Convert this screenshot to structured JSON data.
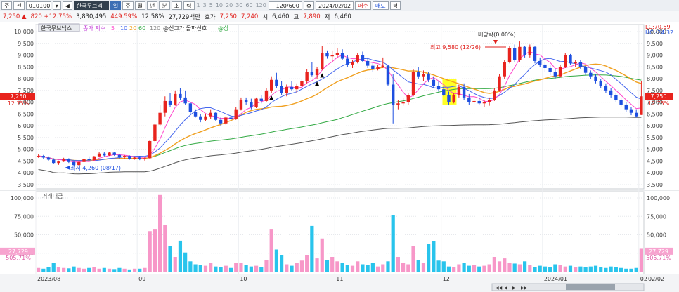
{
  "toolbar": {
    "type_label": "주",
    "board_label": "전",
    "code": "010100",
    "name": "한국무브넥",
    "buttons": [
      "일",
      "주",
      "월",
      "년",
      "분",
      "초",
      "틱"
    ],
    "periods": [
      "1",
      "3",
      "5",
      "10",
      "20",
      "30",
      "60",
      "120"
    ],
    "count": "120",
    "count_total": "/600",
    "date": "2024/02/02",
    "buy": "매수",
    "sell": "매도",
    "avg": "평"
  },
  "quote": {
    "price": "7,250",
    "change": "820",
    "change_pct": "+12.75%",
    "volume": "3,830,495",
    "volume_ratio": "449.59%",
    "turnover": "12.58%",
    "amount": "27,729백만",
    "bid_label": "호가",
    "bid": "7,250",
    "ask": "7,240",
    "open_label": "시",
    "open": "6,460",
    "high_label": "고",
    "high": "7,890",
    "low_label": "저",
    "low": "6,460"
  },
  "legend": {
    "name": "한국무브넥스",
    "ma_title": "종가 지수",
    "ma_periods": [
      "5",
      "10",
      "20",
      "60",
      "120"
    ],
    "signal1": "@신고가 돌파신호",
    "signal2": "@상"
  },
  "annotations": {
    "high_label": "최고 9,580 (12/26)",
    "low_label": "최저 4,260 (08/17)",
    "dividend": "배당락(0.00%)",
    "lc": "LC:70.59",
    "hc": "HC:-24.32",
    "price_tag": "7,250",
    "pct_tag": "12.75%",
    "vol_panel_title": "거래대금",
    "vol_tag": "27,729",
    "vol_pct_tag": "505.71%"
  },
  "chart_data": {
    "type": "candlestick",
    "price_axis": {
      "min": 3500,
      "max": 10000,
      "ticks": [
        3500,
        4000,
        4500,
        5000,
        5500,
        6000,
        6500,
        7000,
        7500,
        8000,
        8500,
        9000,
        9500,
        10000
      ]
    },
    "volume_axis": {
      "min": 0,
      "max": 100000,
      "ticks": [
        25000,
        50000,
        75000,
        100000
      ]
    },
    "x_labels": [
      {
        "label": "2023/08",
        "index": 0
      },
      {
        "label": "09",
        "index": 20
      },
      {
        "label": "10",
        "index": 40
      },
      {
        "label": "11",
        "index": 59
      },
      {
        "label": "12",
        "index": 80
      },
      {
        "label": "2024/01",
        "index": 100
      },
      {
        "label": "02",
        "index": 119
      }
    ],
    "right_date": "02/02",
    "ma_colors": {
      "5": "#ff44cc",
      "10": "#4466ee",
      "20": "#f0a020",
      "60": "#33aa44",
      "120": "#555555"
    },
    "highlight_index": 81,
    "up_arrows": [
      46,
      55,
      56
    ],
    "candles": [
      [
        4700,
        4780,
        4640,
        4720
      ],
      [
        4720,
        4760,
        4600,
        4650
      ],
      [
        4650,
        4700,
        4520,
        4560
      ],
      [
        4560,
        4620,
        4380,
        4420
      ],
      [
        4420,
        4520,
        4340,
        4480
      ],
      [
        4480,
        4640,
        4460,
        4600
      ],
      [
        4600,
        4620,
        4420,
        4460
      ],
      [
        4460,
        4500,
        4260,
        4330
      ],
      [
        4330,
        4500,
        4300,
        4460
      ],
      [
        4460,
        4620,
        4440,
        4600
      ],
      [
        4600,
        4700,
        4500,
        4540
      ],
      [
        4540,
        4720,
        4520,
        4700
      ],
      [
        4700,
        4900,
        4660,
        4820
      ],
      [
        4820,
        4900,
        4700,
        4740
      ],
      [
        4740,
        4880,
        4720,
        4860
      ],
      [
        4860,
        4900,
        4720,
        4760
      ],
      [
        4760,
        4800,
        4600,
        4660
      ],
      [
        4660,
        4760,
        4580,
        4720
      ],
      [
        4720,
        4740,
        4560,
        4600
      ],
      [
        4600,
        4700,
        4560,
        4650
      ],
      [
        4650,
        4720,
        4540,
        4580
      ],
      [
        4580,
        4660,
        4520,
        4620
      ],
      [
        4620,
        5400,
        4600,
        5350
      ],
      [
        5350,
        6100,
        5300,
        6050
      ],
      [
        6050,
        6900,
        6000,
        6550
      ],
      [
        6550,
        7250,
        6400,
        7050
      ],
      [
        7050,
        7400,
        6800,
        6900
      ],
      [
        6900,
        7500,
        6850,
        7350
      ],
      [
        7350,
        7600,
        7100,
        7200
      ],
      [
        7200,
        7500,
        6900,
        6950
      ],
      [
        6950,
        7000,
        6500,
        6600
      ],
      [
        6600,
        6700,
        6350,
        6400
      ],
      [
        6400,
        6500,
        6150,
        6250
      ],
      [
        6250,
        6500,
        6200,
        6400
      ],
      [
        6400,
        6700,
        6300,
        6550
      ],
      [
        6550,
        6600,
        6200,
        6250
      ],
      [
        6250,
        6350,
        6000,
        6100
      ],
      [
        6100,
        6400,
        6050,
        6350
      ],
      [
        6350,
        6500,
        6200,
        6300
      ],
      [
        6300,
        6800,
        6250,
        6700
      ],
      [
        6700,
        7200,
        6650,
        7100
      ],
      [
        7100,
        7200,
        6900,
        7000
      ],
      [
        7000,
        7150,
        6700,
        6800
      ],
      [
        6800,
        7200,
        6750,
        7150
      ],
      [
        7150,
        7300,
        6950,
        7050
      ],
      [
        7050,
        7600,
        7000,
        7500
      ],
      [
        7500,
        8100,
        7400,
        7950
      ],
      [
        7950,
        8250,
        7600,
        7700
      ],
      [
        7700,
        7900,
        7300,
        7400
      ],
      [
        7400,
        7750,
        7250,
        7650
      ],
      [
        7650,
        7900,
        7500,
        7550
      ],
      [
        7550,
        7800,
        7400,
        7700
      ],
      [
        7700,
        8000,
        7600,
        7900
      ],
      [
        7900,
        8400,
        7800,
        8300
      ],
      [
        8300,
        8700,
        8100,
        8150
      ],
      [
        8150,
        8500,
        8000,
        8400
      ],
      [
        8400,
        9400,
        8350,
        9100
      ],
      [
        9100,
        9200,
        8850,
        8950
      ],
      [
        8950,
        9200,
        8700,
        9000
      ],
      [
        9000,
        9300,
        8900,
        9100
      ],
      [
        9100,
        9250,
        8800,
        8850
      ],
      [
        8850,
        9000,
        8500,
        8600
      ],
      [
        8600,
        8800,
        8450,
        8700
      ],
      [
        8700,
        9100,
        8650,
        9000
      ],
      [
        9000,
        9150,
        8700,
        8750
      ],
      [
        8750,
        8900,
        8450,
        8550
      ],
      [
        8550,
        8650,
        8300,
        8400
      ],
      [
        8400,
        8600,
        8350,
        8500
      ],
      [
        8500,
        8900,
        8450,
        8550
      ],
      [
        8550,
        8600,
        7700,
        7750
      ],
      [
        7750,
        8200,
        6100,
        6900
      ],
      [
        6900,
        7100,
        6700,
        6950
      ],
      [
        6950,
        7200,
        6850,
        7000
      ],
      [
        7000,
        7400,
        6900,
        7300
      ],
      [
        7300,
        8400,
        7250,
        8300
      ],
      [
        8300,
        8500,
        8000,
        8100
      ],
      [
        8100,
        8350,
        7900,
        8200
      ],
      [
        8200,
        8300,
        7850,
        7950
      ],
      [
        7950,
        8100,
        7600,
        7700
      ],
      [
        7700,
        7900,
        7450,
        7550
      ],
      [
        7550,
        7700,
        7250,
        7300
      ],
      [
        7300,
        7450,
        6900,
        7000
      ],
      [
        7000,
        7400,
        6950,
        7300
      ],
      [
        7300,
        7750,
        7200,
        7650
      ],
      [
        7650,
        7800,
        7100,
        7200
      ],
      [
        7200,
        7350,
        6900,
        7000
      ],
      [
        7000,
        7200,
        6900,
        7050
      ],
      [
        7050,
        7200,
        6900,
        6950
      ],
      [
        6950,
        7100,
        6800,
        7000
      ],
      [
        7000,
        7200,
        6850,
        7100
      ],
      [
        7100,
        7600,
        7050,
        7500
      ],
      [
        7500,
        8200,
        7450,
        8100
      ],
      [
        8100,
        8800,
        8000,
        8700
      ],
      [
        8700,
        9400,
        8650,
        9300
      ],
      [
        9300,
        9450,
        8700,
        8800
      ],
      [
        8800,
        9580,
        8700,
        9350
      ],
      [
        9350,
        9400,
        8900,
        9000
      ],
      [
        9000,
        9450,
        8900,
        9350
      ],
      [
        9350,
        9400,
        8650,
        8750
      ],
      [
        8750,
        8900,
        8500,
        8600
      ],
      [
        8600,
        8700,
        8300,
        8450
      ],
      [
        8450,
        8600,
        8150,
        8300
      ],
      [
        8300,
        8400,
        8000,
        8100
      ],
      [
        8100,
        8600,
        8050,
        8500
      ],
      [
        8500,
        9100,
        8450,
        9000
      ],
      [
        9000,
        9050,
        8600,
        8650
      ],
      [
        8650,
        8800,
        8500,
        8700
      ],
      [
        8700,
        8800,
        8400,
        8500
      ],
      [
        8500,
        8550,
        8150,
        8250
      ],
      [
        8250,
        8350,
        8000,
        8100
      ],
      [
        8100,
        8200,
        7800,
        7900
      ],
      [
        7900,
        8000,
        7600,
        7700
      ],
      [
        7700,
        7800,
        7400,
        7500
      ],
      [
        7500,
        7600,
        7200,
        7300
      ],
      [
        7300,
        7400,
        7000,
        7100
      ],
      [
        7100,
        7200,
        6800,
        6900
      ],
      [
        6900,
        7000,
        6600,
        6700
      ],
      [
        6700,
        6800,
        6450,
        6550
      ],
      [
        6550,
        6700,
        6350,
        6400
      ],
      [
        6460,
        7890,
        6460,
        7250
      ]
    ],
    "volumes": [
      5000,
      4000,
      6000,
      12000,
      6000,
      5000,
      4500,
      7000,
      5000,
      4000,
      5000,
      6000,
      4000,
      5000,
      4000,
      3500,
      5000,
      4000,
      3000,
      4000,
      4000,
      5000,
      55000,
      58000,
      104000,
      63000,
      35000,
      20000,
      42000,
      26000,
      14000,
      10000,
      9000,
      8000,
      12000,
      7000,
      6000,
      8000,
      5000,
      12000,
      12000,
      9000,
      7000,
      8000,
      6000,
      16000,
      58000,
      30000,
      22000,
      10000,
      8000,
      12000,
      15000,
      22000,
      62000,
      18000,
      45000,
      16000,
      20000,
      14000,
      12000,
      9000,
      8000,
      14000,
      10000,
      9000,
      12000,
      7000,
      10000,
      14000,
      77000,
      20000,
      12000,
      10000,
      35000,
      16000,
      12000,
      38000,
      41000,
      15000,
      14000,
      7000,
      6000,
      10000,
      12000,
      8000,
      9000,
      7000,
      8000,
      10000,
      20000,
      14000,
      18000,
      12000,
      11000,
      10000,
      14000,
      9000,
      6000,
      8000,
      7000,
      6000,
      10000,
      9000,
      7000,
      8000,
      6000,
      7000,
      6000,
      7000,
      8000,
      6000,
      5000,
      7000,
      6000,
      5000,
      4000,
      4000,
      5000,
      31000
    ]
  }
}
